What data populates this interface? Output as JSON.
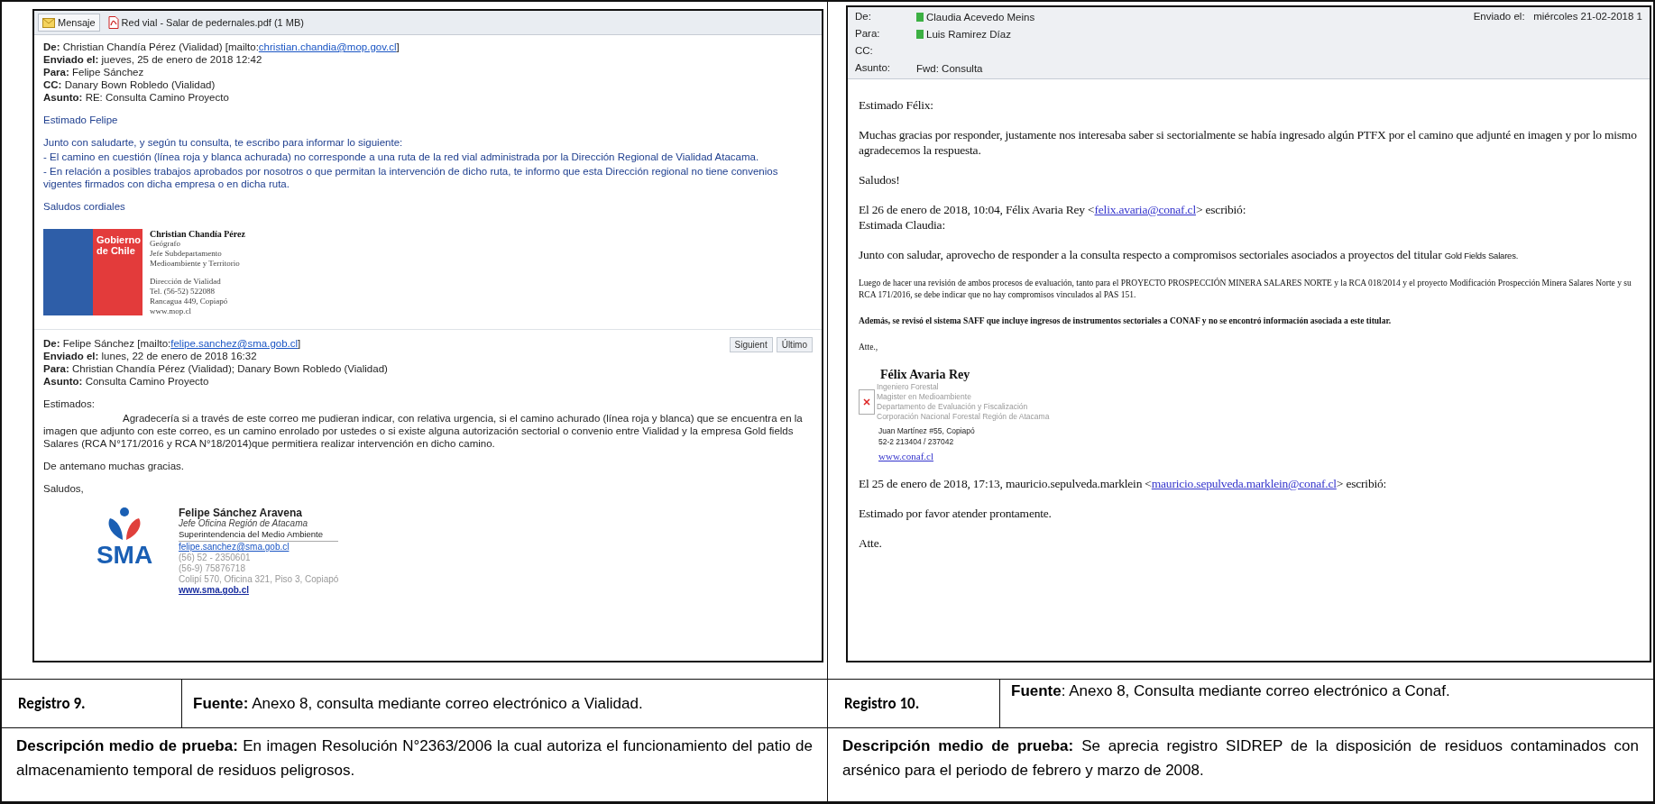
{
  "left_email": {
    "tabs": [
      {
        "label": "Mensaje",
        "kind": "envelope",
        "selected": true
      },
      {
        "label": "Red vial - Salar de pedernales.pdf (1 MB)",
        "kind": "pdf",
        "selected": false
      }
    ],
    "messages": [
      {
        "headers": [
          {
            "label": "De:",
            "value": "Christian Chandía Pérez (Vialidad) [mailto:",
            "link": "christian.chandia@mop.gov.cl",
            "suffix": "]"
          },
          {
            "label": "Enviado el:",
            "value": "jueves, 25 de enero de 2018 12:42"
          },
          {
            "label": "Para:",
            "value": "Felipe Sánchez"
          },
          {
            "label": "CC:",
            "value": "Danary Bown Robledo (Vialidad)"
          },
          {
            "label": "Asunto:",
            "value": "RE: Consulta Camino Proyecto"
          }
        ],
        "kind": "styled",
        "paragraphs": [
          {
            "kind": "p",
            "text": "Estimado Felipe"
          },
          {
            "kind": "p",
            "text": "Junto con saludarte, y según tu consulta, te escribo para informar lo siguiente:"
          },
          {
            "kind": "tight",
            "text": "- El camino en cuestión (línea roja y blanca achurada) no corresponde a una ruta de la red vial administrada por la Dirección Regional de Vialidad Atacama."
          },
          {
            "kind": "tight",
            "text": "- En relación a posibles trabajos aprobados por nosotros o que permitan la intervención de dicho ruta, te informo que esta Dirección regional no tiene convenios vigentes firmados con dicha empresa o en dicha ruta."
          },
          {
            "kind": "p",
            "text": "Saludos cordiales"
          }
        ],
        "signature": {
          "kind": "gov",
          "logo": [
            "Gobierno",
            "de Chile"
          ],
          "name": "Christian Chandía Pérez",
          "lines": [
            "Geógrafo",
            "Jefe Subdepartamento",
            "Medioambiente y Territorio"
          ],
          "contact": [
            "Dirección de Vialidad",
            "Tel. (56-52) 522088",
            "Rancagua 449, Copiapó",
            "www.mop.cl"
          ]
        }
      },
      {
        "headers": [
          {
            "label": "De:",
            "value": "Felipe Sánchez [mailto:",
            "link": "felipe.sanchez@sma.gob.cl",
            "suffix": "]"
          },
          {
            "label": "Enviado el:",
            "value": "lunes, 22 de enero de 2018 16:32"
          },
          {
            "label": "Para:",
            "value": "Christian Chandía Pérez (Vialidad); Danary Bown Robledo (Vialidad)"
          },
          {
            "label": "Asunto:",
            "value": "Consulta Camino Proyecto"
          }
        ],
        "nav": [
          "Siguient",
          "Último"
        ],
        "kind": "plain",
        "paragraphs": [
          {
            "kind": "p",
            "text": "Estimados:"
          },
          {
            "kind": "indented",
            "text": "Agradecería si a través de este correo me pudieran indicar, con relativa urgencia, si el camino achurado (línea roja y blanca) que se encuentra en la imagen que adjunto con este correo, es un camino enrolado por ustedes o si existe alguna autorización sectorial o convenio entre Vialidad y la empresa Gold fields Salares (RCA N°171/2016 y RCA N°18/2014)que permitiera realizar intervención en dicho camino."
          },
          {
            "kind": "p",
            "text": "De antemano muchas gracias."
          },
          {
            "kind": "p",
            "text": "Saludos,"
          }
        ],
        "signature": {
          "kind": "sma",
          "logo": [
            "SMA"
          ],
          "name": "Felipe Sánchez Aravena",
          "lines": [
            "Jefe Oficina Región de Atacama",
            "Superintendencia del Medio Ambiente"
          ],
          "email": "felipe.sanchez@sma.gob.cl",
          "contact": [
            "(56) 52 - 2350601",
            "(56-9) 75876718",
            "Colipí 570, Oficina 321, Piso 3, Copiapó"
          ],
          "web": "www.sma.gob.cl"
        }
      }
    ]
  },
  "right_email": {
    "headers": [
      {
        "label": "De:",
        "value": "Claudia Acevedo Meins",
        "online": true
      },
      {
        "label": "Para:",
        "value": "Luis Ramirez Díaz",
        "online": true
      },
      {
        "label": "CC:",
        "online": false
      },
      {
        "label": "Asunto:",
        "value": "Fwd: Consulta",
        "online": false
      }
    ],
    "sent_label": "Enviado el:",
    "sent_value": "miércoles 21-02-2018 1",
    "body": [
      {
        "kind": "large",
        "text": "Estimado Félix:"
      },
      {
        "kind": "large",
        "text": "Muchas gracias por responder, justamente nos interesaba saber si sectorialmente se había ingresado algún PTFX por el camino que adjunté en imagen y por lo mismo agradecemos la respuesta."
      },
      {
        "kind": "large",
        "text": "Saludos!"
      },
      {
        "kind": "attribution",
        "text": "El 26 de enero de 2018, 10:04, Félix Avaria Rey <",
        "link": "felix.avaria@conaf.cl",
        "suffix": "> escribió:"
      },
      {
        "kind": "tight",
        "text": "Estimada Claudia:"
      },
      {
        "kind": "large",
        "text": "Junto con saludar, aprovecho de responder a la consulta respecto a compromisos sectoriales asociados a proyectos del titular",
        "aside": "Gold Fields Salares."
      },
      {
        "kind": "small",
        "text": "Luego de hacer una revisión de ambos procesos de evaluación, tanto para el PROYECTO PROSPECCIÓN MINERA SALARES NORTE y la RCA 018/2014 y el proyecto Modificación Prospección Minera Salares Norte y su RCA 171/2016, se debe indicar que no hay compromisos vinculados al PAS 151."
      },
      {
        "kind": "small-bold",
        "text": "Además, se revisó el sistema SAFF que incluye ingresos de instrumentos sectoriales a CONAF y no se encontró información asociada a este titular."
      },
      {
        "kind": "small",
        "text": "Atte.,"
      },
      {
        "kind": "signature",
        "name": "Félix Avaria Rey",
        "lines": [
          "Ingeniero Forestal",
          "Magister en Medioambiente",
          "Departamento de Evaluación y Fiscalización",
          "Corporación Nacional Forestal Región de Atacama"
        ],
        "contact": [
          "Juan Martínez #55, Copiapó",
          "52-2 213404 / 237042"
        ],
        "link": "www.conaf.cl"
      },
      {
        "kind": "attribution",
        "text": "El 25 de enero de 2018, 17:13, mauricio.sepulveda.marklein <",
        "link": "mauricio.sepulveda.marklein@conaf.cl",
        "suffix": "> escribió:"
      },
      {
        "kind": "large",
        "text": "Estimado por favor atender prontamente."
      },
      {
        "kind": "large",
        "text": "Atte."
      }
    ]
  },
  "records": [
    {
      "registro": "Registro 9.",
      "fuente": "**Fuente:** Anexo 8, consulta mediante correo electrónico a Vialidad.",
      "descripcion": "**Descripción medio de prueba:** En imagen Resolución N°2363/2006 la cual autoriza el funcionamiento del patio de almacenamiento temporal de residuos peligrosos."
    },
    {
      "registro": "Registro 10.",
      "fuente": "**Fuente**: Anexo 8, Consulta mediante correo electrónico a Conaf.",
      "descripcion": "**Descripción medio de prueba:** Se aprecia registro SIDREP de la disposición de residuos contaminados con arsénico para el periodo de febrero y marzo de 2008."
    }
  ]
}
